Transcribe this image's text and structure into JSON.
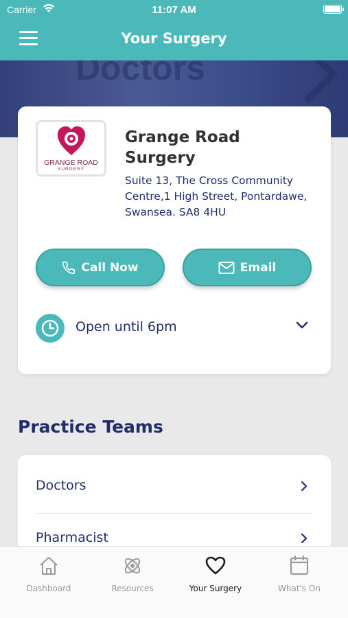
{
  "status_bar": {
    "carrier": "Carrier",
    "time": "11:07 AM"
  },
  "header": {
    "title": "Your Surgery",
    "menu_icon": "hamburger-icon"
  },
  "hero": {
    "sign_text": "Doctors"
  },
  "surgery": {
    "logo_text": "GRANGE ROAD",
    "logo_subtext": "SURGERY",
    "name": "Grange Road Surgery",
    "address": "Suite 13, The Cross Community Centre,1 High Street, Pontardawe, Swansea. SA8 4HU",
    "call_label": "Call Now",
    "email_label": "Email",
    "hours": "Open until 6pm"
  },
  "practice_teams": {
    "title": "Practice Teams",
    "items": [
      {
        "label": "Doctors"
      },
      {
        "label": "Pharmacist"
      }
    ]
  },
  "tabs": [
    {
      "label": "Dashboard",
      "icon": "home-icon",
      "active": false
    },
    {
      "label": "Resources",
      "icon": "atom-icon",
      "active": false
    },
    {
      "label": "Your Surgery",
      "icon": "heart-icon",
      "active": true
    },
    {
      "label": "What's On",
      "icon": "calendar-icon",
      "active": false
    }
  ],
  "colors": {
    "accent": "#4bb9b9",
    "navy": "#1f2d6b",
    "logo": "#c2185b"
  }
}
